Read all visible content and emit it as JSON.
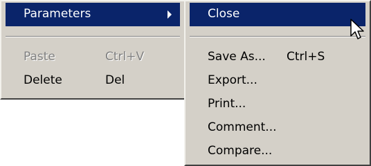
{
  "main_menu": {
    "items": [
      {
        "label": "Parameters",
        "shortcut": ""
      },
      {
        "label": "Paste",
        "shortcut": "Ctrl+V"
      },
      {
        "label": "Delete",
        "shortcut": "Del"
      }
    ]
  },
  "sub_menu": {
    "items": [
      {
        "label": "Close",
        "shortcut": ""
      },
      {
        "label": "Save As...",
        "shortcut": "Ctrl+S"
      },
      {
        "label": "Export...",
        "shortcut": ""
      },
      {
        "label": "Print...",
        "shortcut": ""
      },
      {
        "label": "Comment...",
        "shortcut": ""
      },
      {
        "label": "Compare...",
        "shortcut": ""
      }
    ]
  },
  "colors": {
    "menu_bg": "#d4d0c8",
    "highlight_bg": "#0a246a",
    "highlight_text": "#ffffff",
    "disabled_text": "#808080"
  }
}
